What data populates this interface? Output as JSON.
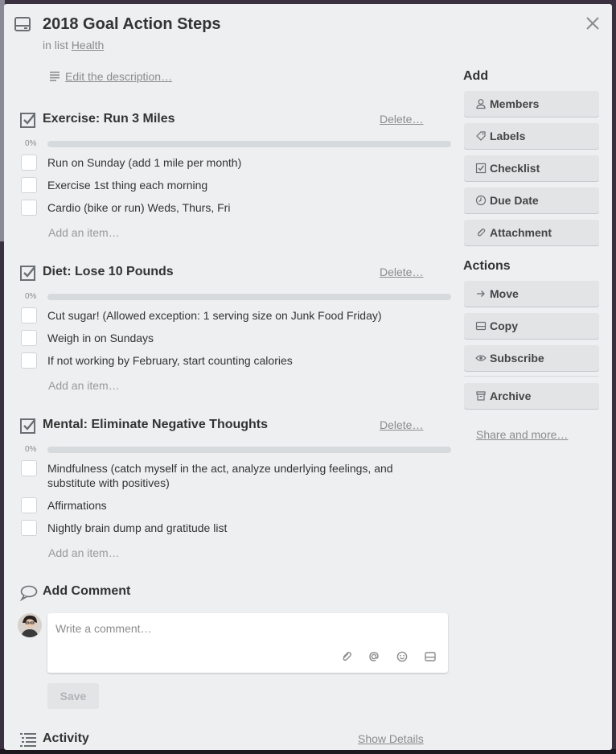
{
  "card": {
    "title": "2018 Goal Action Steps",
    "in_list_prefix": "in list",
    "list_name": "Health",
    "description_link": "Edit the description…"
  },
  "checklists": [
    {
      "title": "Exercise: Run 3 Miles",
      "delete_label": "Delete…",
      "percent_label": "0%",
      "progress": 0,
      "items": [
        "Run on Sunday (add 1 mile per month)",
        "Exercise 1st thing each morning",
        "Cardio (bike or run) Weds, Thurs, Fri"
      ],
      "add_item_label": "Add an item…"
    },
    {
      "title": "Diet: Lose 10 Pounds",
      "delete_label": "Delete…",
      "percent_label": "0%",
      "progress": 0,
      "items": [
        "Cut sugar! (Allowed exception: 1 serving size on Junk Food Friday)",
        "Weigh in on Sundays",
        "If not working by February, start counting calories"
      ],
      "add_item_label": "Add an item…"
    },
    {
      "title": "Mental: Eliminate Negative Thoughts",
      "delete_label": "Delete…",
      "percent_label": "0%",
      "progress": 0,
      "items": [
        "Mindfulness (catch myself in the act, analyze underlying feelings, and substitute with positives)",
        "Affirmations",
        "Nightly brain dump and gratitude list"
      ],
      "add_item_label": "Add an item…"
    }
  ],
  "comment": {
    "heading": "Add Comment",
    "placeholder": "Write a comment…",
    "save_label": "Save"
  },
  "activity": {
    "heading": "Activity",
    "show_details_label": "Show Details"
  },
  "sidebar": {
    "add_heading": "Add",
    "add_buttons": [
      {
        "label": "Members",
        "icon": "person-icon"
      },
      {
        "label": "Labels",
        "icon": "tag-icon"
      },
      {
        "label": "Checklist",
        "icon": "checkbox-icon"
      },
      {
        "label": "Due Date",
        "icon": "clock-icon"
      },
      {
        "label": "Attachment",
        "icon": "paperclip-icon"
      }
    ],
    "actions_heading": "Actions",
    "action_buttons": [
      {
        "label": "Move",
        "icon": "arrow-right-icon"
      },
      {
        "label": "Copy",
        "icon": "card-icon"
      },
      {
        "label": "Subscribe",
        "icon": "eye-icon"
      }
    ],
    "archive_label": "Archive",
    "share_label": "Share and more…"
  },
  "colors": {
    "modal_bg": "#edeff0",
    "button_bg": "#e2e4e6",
    "progress_track": "#d6dadc",
    "muted_text": "#8c8c8c"
  }
}
